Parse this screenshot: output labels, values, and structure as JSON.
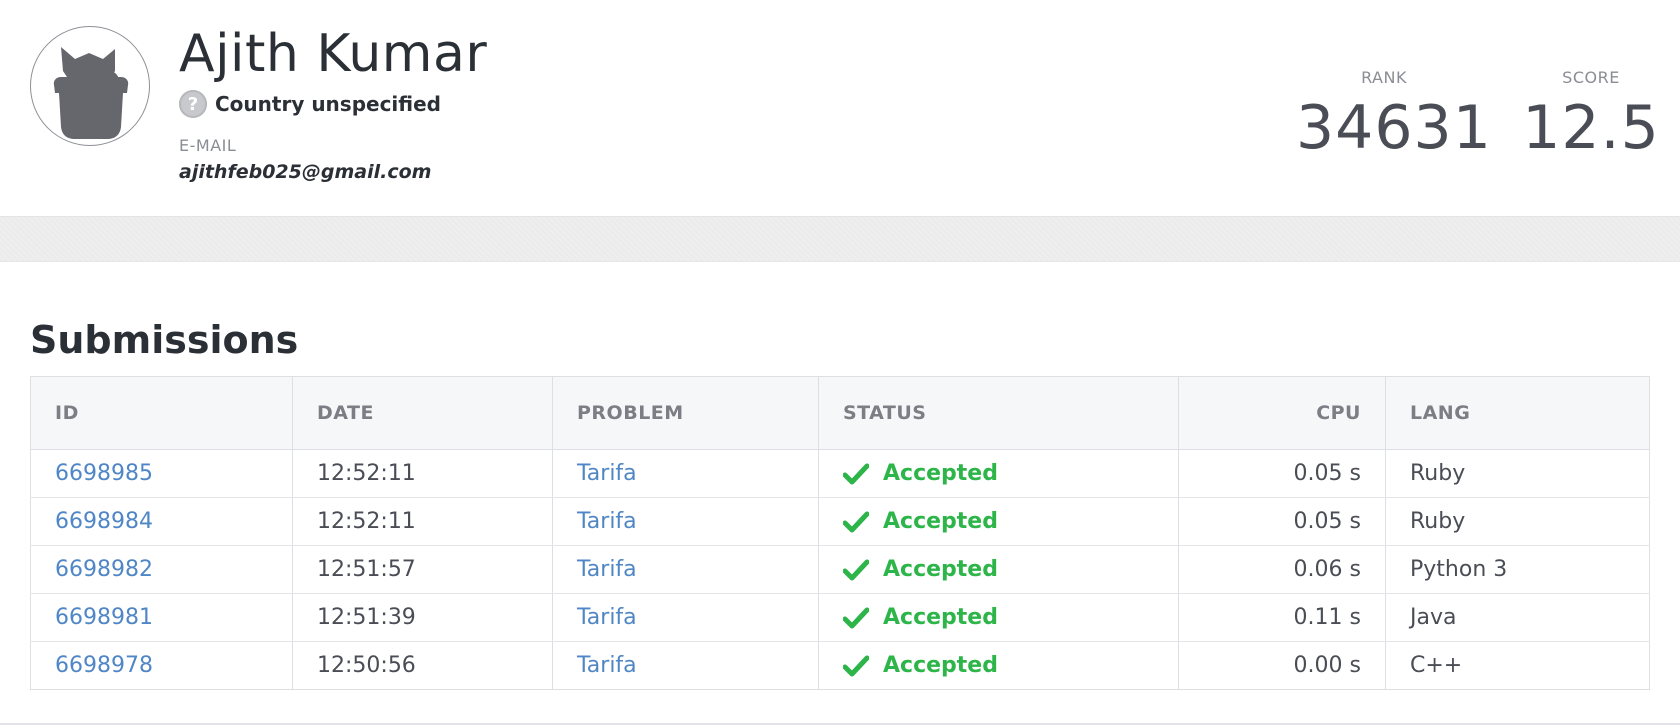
{
  "profile": {
    "name": "Ajith Kumar",
    "country": "Country unspecified",
    "country_icon": "?",
    "email_label": "E-MAIL",
    "email": "ajithfeb025@gmail.com",
    "rank_label": "RANK",
    "rank": "34631",
    "score_label": "SCORE",
    "score": "12.5"
  },
  "submissions": {
    "title": "Submissions",
    "columns": {
      "id": "ID",
      "date": "DATE",
      "problem": "PROBLEM",
      "status": "STATUS",
      "cpu": "CPU",
      "lang": "LANG"
    },
    "rows": [
      {
        "id": "6698985",
        "date": "12:52:11",
        "problem": "Tarifa",
        "status": "Accepted",
        "cpu": "0.05 s",
        "lang": "Ruby"
      },
      {
        "id": "6698984",
        "date": "12:52:11",
        "problem": "Tarifa",
        "status": "Accepted",
        "cpu": "0.05 s",
        "lang": "Ruby"
      },
      {
        "id": "6698982",
        "date": "12:51:57",
        "problem": "Tarifa",
        "status": "Accepted",
        "cpu": "0.06 s",
        "lang": "Python 3"
      },
      {
        "id": "6698981",
        "date": "12:51:39",
        "problem": "Tarifa",
        "status": "Accepted",
        "cpu": "0.11 s",
        "lang": "Java"
      },
      {
        "id": "6698978",
        "date": "12:50:56",
        "problem": "Tarifa",
        "status": "Accepted",
        "cpu": "0.00 s",
        "lang": "C++"
      }
    ]
  },
  "colors": {
    "link": "#4f86c6",
    "accepted": "#2db54a",
    "text": "#2b2f36",
    "muted": "#8a8d93"
  },
  "icons": {
    "avatar": "default-avatar-icon",
    "country": "question-mark-icon",
    "status": "checkmark-icon"
  }
}
